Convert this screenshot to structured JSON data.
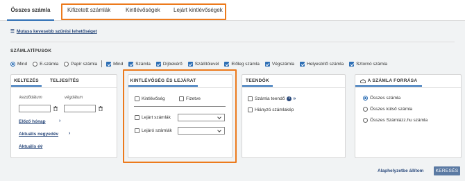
{
  "tabs": [
    {
      "label": "Összes számla",
      "active": true
    },
    {
      "label": "Kifizetett számlák"
    },
    {
      "label": "Kintlévőségek"
    },
    {
      "label": "Lejárt kintlévőségek"
    }
  ],
  "filter_toggle": "Mutass kevesebb szűrési lehetőséget",
  "invoice_types": {
    "title": "SZÁMLATÍPUSOK",
    "radios": [
      {
        "label": "Mind",
        "checked": true
      },
      {
        "label": "E-számla",
        "checked": false
      },
      {
        "label": "Papír számla",
        "checked": false
      }
    ],
    "checkboxes": [
      {
        "label": "Mind",
        "checked": true
      },
      {
        "label": "Számla",
        "checked": true
      },
      {
        "label": "Díjbekérő",
        "checked": true
      },
      {
        "label": "Szállítólevél",
        "checked": true
      },
      {
        "label": "Előleg számla",
        "checked": true
      },
      {
        "label": "Végszámla",
        "checked": true
      },
      {
        "label": "Helyesbítő számla",
        "checked": true
      },
      {
        "label": "Sztornó számla",
        "checked": true
      }
    ]
  },
  "date_card": {
    "tabs": [
      "KELTEZÉS",
      "TELJESÍTÉS"
    ],
    "from_label": "kezdődátum",
    "to_label": "végdátum",
    "from_value": "",
    "to_value": "",
    "links": [
      "Előző hónap",
      "Aktuális negyedév",
      "Aktuális év"
    ]
  },
  "due_card": {
    "title": "KINTLÉVŐSÉG ÉS LEJÁRAT",
    "outstanding": "Kintlévőség",
    "paid": "Fizetve",
    "overdue": "Lejárt számlák",
    "due_soon": "Lejáró számlák",
    "overdue_select": "",
    "due_soon_select": ""
  },
  "todo_card": {
    "title": "TEENDŐK",
    "items": [
      "Számla teendő",
      "Hiányzó számlakép"
    ]
  },
  "source_card": {
    "title": "A SZÁMLA FORRÁSA",
    "options": [
      {
        "label": "Összes számla",
        "checked": true
      },
      {
        "label": "Összes külső számla",
        "checked": false
      },
      {
        "label": "Összes Számlázz.hu számla",
        "checked": false
      }
    ]
  },
  "actions": {
    "reset": "Alaphelyzetbe állítom",
    "search": "KERESÉS"
  },
  "colors": {
    "accent": "#2e6fb5",
    "highlight": "#ec7a1c",
    "link": "#2b4a7c",
    "button": "#5b7aa3"
  }
}
